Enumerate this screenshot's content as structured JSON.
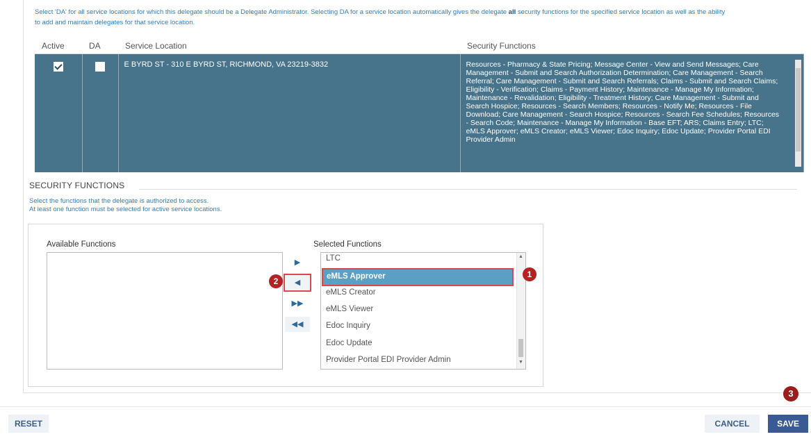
{
  "info_text": {
    "part1": "Select 'DA' for all service locations for which this delegate should be a Delegate Administrator. Selecting DA for a service location automatically gives the delegate ",
    "bold": "all",
    "part2": " security functions for the specified service location as well as the ability to add and maintain delegates for that service location."
  },
  "table": {
    "headers": {
      "active": "Active",
      "da": "DA",
      "location": "Service Location",
      "functions": "Security Functions"
    },
    "row": {
      "active_checked": true,
      "da_checked": false,
      "location": "E BYRD ST - 310 E BYRD ST, RICHMOND, VA 23219-3832",
      "functions": "Resources - Pharmacy & State Pricing; Message Center - View and Send Messages; Care Management - Submit and Search Authorization Determination; Care Management - Search Referral; Care Management - Submit and Search Referrals; Claims - Submit and Search Claims; Eligibility - Verification; Claims - Payment History; Maintenance - Manage My Information; Maintenance - Revalidation; Eligibility - Treatment History; Care Management - Submit and Search Hospice; Resources - Search Members; Resources - Notify Me; Resources - File Download; Care Management - Search Hospice; Resources - Search Fee Schedules; Resources - Search Code; Maintenance - Manage My Information - Base EFT; ARS; Claims Entry; LTC; eMLS Approver; eMLS Creator; eMLS Viewer; Edoc Inquiry; Edoc Update; Provider Portal EDI Provider Admin"
    }
  },
  "security_functions": {
    "title": "SECURITY FUNCTIONS",
    "desc_line1": "Select the functions that the delegate is authorized to access.",
    "desc_line2": "At least one function must be selected for active service locations.",
    "available_label": "Available Functions",
    "selected_label": "Selected Functions",
    "selected_items": [
      "LTC",
      "eMLS Approver",
      "eMLS Creator",
      "eMLS Viewer",
      "Edoc Inquiry",
      "Edoc Update",
      "Provider Portal EDI Provider Admin"
    ],
    "highlighted_item": "eMLS Approver"
  },
  "badges": {
    "one": "1",
    "two": "2",
    "three": "3"
  },
  "buttons": {
    "reset": "RESET",
    "cancel": "CANCEL",
    "save": "SAVE"
  },
  "colors": {
    "row_bg": "#47738b",
    "highlight": "#5aa0c4",
    "callout_red": "#d94a4a",
    "save_bg": "#3a5a94"
  },
  "icons": {
    "move_right": "arrow-right-icon",
    "move_left": "arrow-left-icon",
    "move_all_right": "double-arrow-right-icon",
    "move_all_left": "double-arrow-left-icon"
  }
}
